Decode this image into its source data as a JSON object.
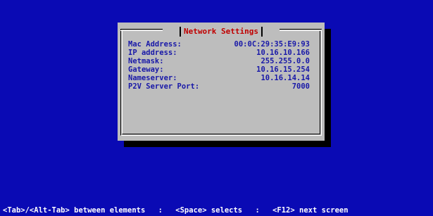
{
  "dialog": {
    "title": "Network Settings",
    "fields": [
      {
        "label": "Mac Address:",
        "value": "00:0C:29:35:E9:93"
      },
      {
        "label": "IP address:",
        "value": "10.16.10.166"
      },
      {
        "label": "Netmask:",
        "value": "255.255.0.0"
      },
      {
        "label": "Gateway:",
        "value": "10.16.15.254"
      },
      {
        "label": "Nameserver:",
        "value": "10.16.14.14"
      },
      {
        "label": "P2V Server Port:",
        "value": "7000"
      }
    ]
  },
  "statusbar": {
    "hint1": "<Tab>/<Alt-Tab> between elements",
    "separator": ":",
    "hint2": "<Space> selects",
    "hint3": "<F12> next screen"
  },
  "colors": {
    "background": "#0a0ab4",
    "dialog": "#bdbdbd",
    "title": "#c00000",
    "field_text": "#1818a8",
    "status_text": "#ffffff"
  }
}
